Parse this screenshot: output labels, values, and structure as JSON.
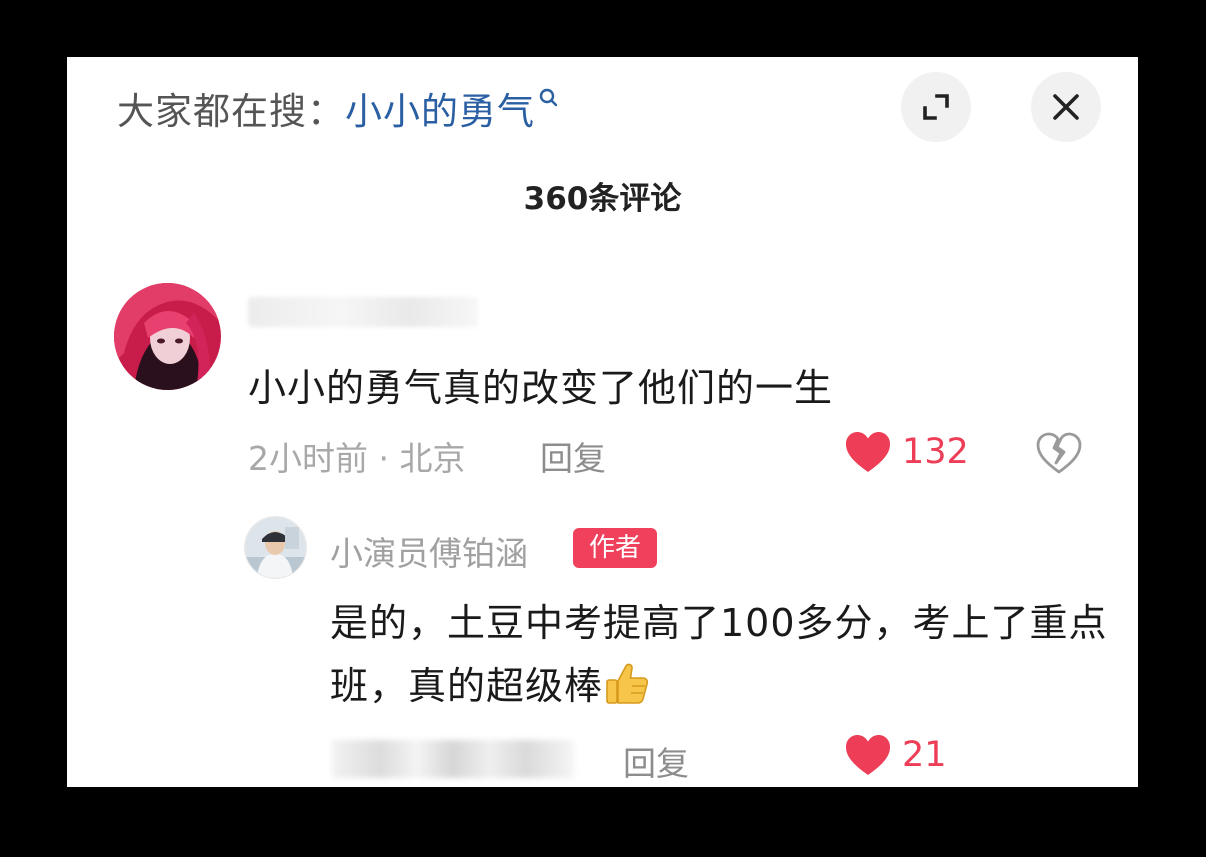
{
  "header": {
    "search_prefix": "大家都在搜：",
    "search_term": "小小的勇气",
    "search_icon": "search-icon",
    "expand_icon": "expand-icon",
    "close_icon": "close-icon"
  },
  "comment_count": "360条评论",
  "comment": {
    "text": "小小的勇气真的改变了他们的一生",
    "meta": "2小时前 · 北京",
    "reply_label": "回复",
    "likes": "132",
    "liked": true,
    "like_icon": "heart-icon",
    "dislike_icon": "broken-heart-icon"
  },
  "reply": {
    "author": "小演员傅铂涵",
    "badge": "作者",
    "text": "是的，土豆中考提高了100多分，考上了重点班，真的超级棒",
    "emoji_icon": "thumbs-up-icon",
    "reply_label": "回复",
    "likes": "21"
  },
  "colors": {
    "accent_red": "#ee3d56",
    "link_blue": "#2b5fa3",
    "badge_red": "#f0415c"
  }
}
